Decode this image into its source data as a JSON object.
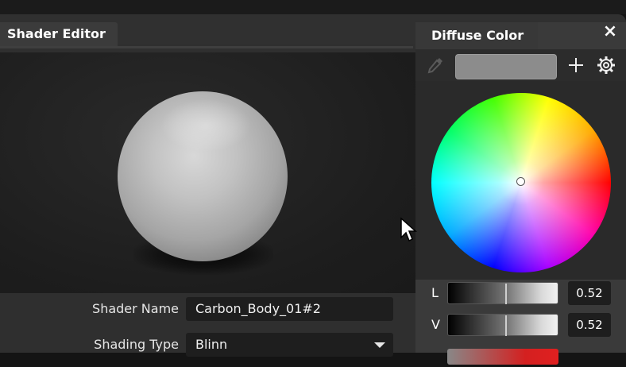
{
  "shader_editor": {
    "tab_title": "Shader Editor",
    "properties": [
      {
        "label": "Shader Name",
        "value": "Carbon_Body_01#2"
      },
      {
        "label": "Shading Type",
        "value": "Blinn"
      }
    ]
  },
  "diffuse_color": {
    "tab_title": "Diffuse Color",
    "close_icon": "×",
    "swatch_color": "#8c8c8c",
    "sliders": [
      {
        "label": "L",
        "value": "0.52",
        "fraction": 0.52
      },
      {
        "label": "V",
        "value": "0.52",
        "fraction": 0.52
      }
    ],
    "icons": [
      "eyedropper-icon",
      "plus-icon",
      "gear-icon",
      "close-icon"
    ]
  }
}
